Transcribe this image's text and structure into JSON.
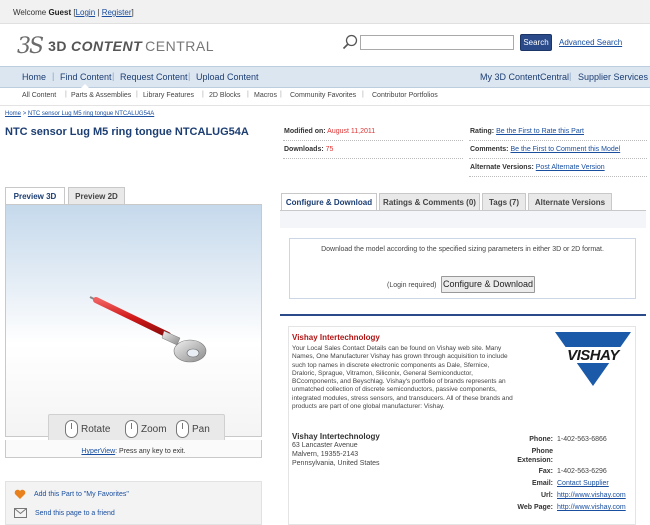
{
  "welcome": {
    "prefix": "Welcome",
    "user": "Guest",
    "login": "Login",
    "register": "Register"
  },
  "header": {
    "logo_ds": "3S",
    "logo_3d": "3D",
    "logo_content": "CONTENT",
    "logo_central": "CENTRAL",
    "search_placeholder": "",
    "search_button": "Search",
    "advanced_search": "Advanced Search"
  },
  "main_nav": {
    "home": "Home",
    "find_content": "Find Content",
    "request_content": "Request Content",
    "upload_content": "Upload Content",
    "my_3dcc": "My 3D ContentCentral",
    "supplier_services": "Supplier Services"
  },
  "sub_nav": [
    "All Content",
    "Parts & Assemblies",
    "Library Features",
    "2D Blocks",
    "Macros",
    "Community Favorites",
    "Contributor Portfolios"
  ],
  "breadcrumb": {
    "home": "Home",
    "separator": ">",
    "current": "NTC sensor Lug M5 ring tongue NTCALUG54A"
  },
  "page_title": "NTC sensor Lug M5 ring tongue NTCALUG54A",
  "meta": {
    "modified_label": "Modified on:",
    "modified_value": "August 11,2011",
    "downloads_label": "Downloads:",
    "downloads_value": "75",
    "rating_label": "Rating:",
    "rating_link": "Be the First to Rate this Part",
    "comments_label": "Comments:",
    "comments_link": "Be the First to Comment this Model",
    "alt_label": "Alternate Versions:",
    "alt_link": "Post Alternate Version"
  },
  "preview_tabs": [
    "Preview 3D",
    "Preview 2D"
  ],
  "viewer": {
    "rotate": "Rotate",
    "zoom": "Zoom",
    "pan": "Pan",
    "hyperview": "HyperView",
    "hyperview_note": ": Press any key to exit."
  },
  "actions": {
    "favorites": "Add this Part to \"My Favorites\"",
    "send": "Send this page to a friend"
  },
  "right_tabs": [
    "Configure & Download",
    "Ratings & Comments (0)",
    "Tags (7)",
    "Alternate Versions"
  ],
  "configure": {
    "description": "Download the model according to the specified sizing parameters in either 3D or 2D format.",
    "login_required": "(Login required)",
    "button": "Configure & Download"
  },
  "vendor": {
    "title": "Vishay Intertechnology",
    "description": "Your Local Sales Contact Details can be found on Vishay web site. Many Names, One Manufacturer Vishay has grown through acquisition to include such top names in discrete electronic components as Dale, Sfernice, Draloric, Sprague, Vitramon, Siliconix, General Semiconductor, BCcomponents, and Beyschlag. Vishay's portfolio of brands represents an unmatched collection of discrete semiconductors, passive components, integrated modules, stress sensors, and transducers. All of these brands and products are part of one global manufacturer: Vishay.",
    "name": "Vishay Intertechnology",
    "address": [
      "63 Lancaster Avenue",
      "Malvern, 19355-2143",
      "Pennsylvania, United States"
    ],
    "logo_text": "VISHAY",
    "contact": {
      "phone_label": "Phone:",
      "phone_value": "1-402-563-6866",
      "ext_label_1": "Phone",
      "ext_label_2": "Extension:",
      "fax_label": "Fax:",
      "fax_value": "1-402-563-6296",
      "email_label": "Email:",
      "email_value": "Contact Supplier",
      "url_label": "Url:",
      "url_value": "http://www.vishay.com",
      "web_label": "Web Page:",
      "web_value": "http://www.vishay.com"
    }
  },
  "colors": {
    "nav_bg": "#dce6f1",
    "brand_blue": "#1c3e73",
    "link": "#1a4fa0",
    "vendor_red": "#b01515",
    "vishay_blue": "#1a5aa8"
  }
}
